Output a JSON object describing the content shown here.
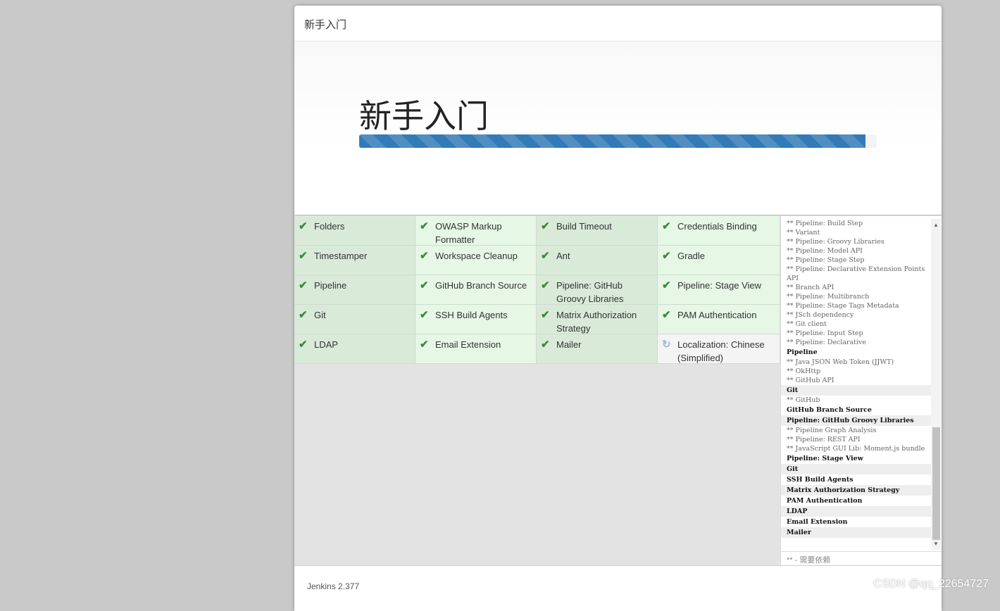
{
  "dialog": {
    "title": "新手入门",
    "heading": "新手入门",
    "progress_percent": 97.8,
    "progress_color": "#337ab7"
  },
  "plugins": [
    {
      "name": "Folders",
      "status": "installed"
    },
    {
      "name": "OWASP Markup Formatter",
      "status": "installed"
    },
    {
      "name": "Build Timeout",
      "status": "installed"
    },
    {
      "name": "Credentials Binding",
      "status": "installed"
    },
    {
      "name": "Timestamper",
      "status": "installed"
    },
    {
      "name": "Workspace Cleanup",
      "status": "installed"
    },
    {
      "name": "Ant",
      "status": "installed"
    },
    {
      "name": "Gradle",
      "status": "installed"
    },
    {
      "name": "Pipeline",
      "status": "installed"
    },
    {
      "name": "GitHub Branch Source",
      "status": "installed"
    },
    {
      "name": "Pipeline: GitHub Groovy Libraries",
      "status": "installed"
    },
    {
      "name": "Pipeline: Stage View",
      "status": "installed"
    },
    {
      "name": "Git",
      "status": "installed"
    },
    {
      "name": "SSH Build Agents",
      "status": "installed"
    },
    {
      "name": "Matrix Authorization Strategy",
      "status": "installed"
    },
    {
      "name": "PAM Authentication",
      "status": "installed"
    },
    {
      "name": "LDAP",
      "status": "installed"
    },
    {
      "name": "Email Extension",
      "status": "installed"
    },
    {
      "name": "Mailer",
      "status": "installed"
    },
    {
      "name": "Localization: Chinese (Simplified)",
      "status": "installing"
    }
  ],
  "log": [
    {
      "t": "** Pipeline: Build Step",
      "dep": true
    },
    {
      "t": "** Variant",
      "dep": true
    },
    {
      "t": "** Pipeline: Groovy Libraries",
      "dep": true
    },
    {
      "t": "** Pipeline: Model API",
      "dep": true
    },
    {
      "t": "** Pipeline: Stage Step",
      "dep": true
    },
    {
      "t": "** Pipeline: Declarative Extension Points API",
      "dep": true
    },
    {
      "t": "** Branch API",
      "dep": true
    },
    {
      "t": "** Pipeline: Multibranch",
      "dep": true
    },
    {
      "t": "** Pipeline: Stage Tags Metadata",
      "dep": true
    },
    {
      "t": "** JSch dependency",
      "dep": true
    },
    {
      "t": "** Git client",
      "dep": true
    },
    {
      "t": "** Pipeline: Input Step",
      "dep": true
    },
    {
      "t": "** Pipeline: Declarative",
      "dep": true
    },
    {
      "t": "Pipeline",
      "dep": false
    },
    {
      "t": "** Java JSON Web Token (JJWT)",
      "dep": true
    },
    {
      "t": "** OkHttp",
      "dep": true
    },
    {
      "t": "** GitHub API",
      "dep": true
    },
    {
      "t": "Git",
      "dep": false
    },
    {
      "t": "** GitHub",
      "dep": true
    },
    {
      "t": "GitHub Branch Source",
      "dep": false
    },
    {
      "t": "Pipeline: GitHub Groovy Libraries",
      "dep": false
    },
    {
      "t": "** Pipeline Graph Analysis",
      "dep": true
    },
    {
      "t": "** Pipeline: REST API",
      "dep": true
    },
    {
      "t": "** JavaScript GUI Lib: Moment.js bundle",
      "dep": true
    },
    {
      "t": "Pipeline: Stage View",
      "dep": false
    },
    {
      "t": "Git",
      "dep": false
    },
    {
      "t": "SSH Build Agents",
      "dep": false
    },
    {
      "t": "Matrix Authorization Strategy",
      "dep": false
    },
    {
      "t": "PAM Authentication",
      "dep": false
    },
    {
      "t": "LDAP",
      "dep": false
    },
    {
      "t": "Email Extension",
      "dep": false
    },
    {
      "t": "Mailer",
      "dep": false
    }
  ],
  "legend": "** - 需要依赖",
  "footer": {
    "version": "Jenkins 2.377"
  },
  "watermark": "CSDN @qq_22654727"
}
